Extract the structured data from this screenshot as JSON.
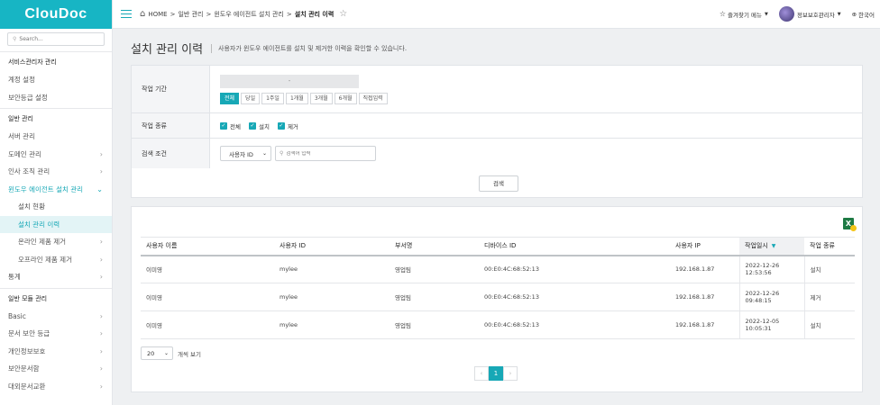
{
  "app": {
    "logo": "ClouDoc"
  },
  "sidebar": {
    "search_placeholder": "Search...",
    "sections": [
      {
        "title": "서비스관리자 관리",
        "items": [
          {
            "label": "계정 설정",
            "chevron": ""
          },
          {
            "label": "보안등급 설정",
            "chevron": ""
          }
        ]
      },
      {
        "title": "일반 관리",
        "items": [
          {
            "label": "서버 관리",
            "chevron": ""
          },
          {
            "label": "도메인 관리",
            "chevron": "›"
          },
          {
            "label": "인사 조직 관리",
            "chevron": "›"
          },
          {
            "label": "윈도우 에이전트 설치 관리",
            "chevron": "⌄"
          },
          {
            "label": "설치 현황",
            "chevron": ""
          },
          {
            "label": "설치 관리 이력",
            "chevron": ""
          },
          {
            "label": "온라인 제품 제거",
            "chevron": "›"
          },
          {
            "label": "오프라인 제품 제거",
            "chevron": "›"
          },
          {
            "label": "통계",
            "chevron": "›"
          }
        ]
      },
      {
        "title": "일반 모듈 관리",
        "items": [
          {
            "label": "Basic",
            "chevron": "›"
          },
          {
            "label": "문서 보안 등급",
            "chevron": "›"
          },
          {
            "label": "개인정보보호",
            "chevron": "›"
          },
          {
            "label": "보안문서함",
            "chevron": "›"
          },
          {
            "label": "대외문서교환",
            "chevron": "›"
          }
        ]
      }
    ]
  },
  "topbar": {
    "breadcrumb": [
      "HOME",
      "일반 관리",
      "윈도우 에이전트 설치 관리",
      "설치 관리 이력"
    ],
    "favorites": "즐겨찾기 메뉴",
    "user": "정보보호관리자",
    "language": "한국어"
  },
  "page": {
    "title": "설치 관리 이력",
    "description": "사용자가 윈도우 에이전트를 설치 및 제거한 이력을 확인할 수 있습니다."
  },
  "filter": {
    "period_label": "작업 기간",
    "date_value": "-",
    "period_buttons": [
      "전체",
      "당일",
      "1주일",
      "1개월",
      "3개월",
      "6개월",
      "직접입력"
    ],
    "type_label": "작업 종류",
    "types": [
      "전체",
      "설치",
      "제거"
    ],
    "condition_label": "검색 조건",
    "condition_select": "사용자 ID",
    "keyword_placeholder": "검색어 입력",
    "search_button": "검색"
  },
  "table": {
    "headers": [
      "사용자 이름",
      "사용자 ID",
      "부서명",
      "디바이스 ID",
      "사용자 IP",
      "작업일시",
      "작업 종류"
    ],
    "rows": [
      [
        "이미영",
        "mylee",
        "영업팀",
        "00:E0:4C:68:52:13",
        "192.168.1.87",
        "2022-12-26",
        "12:53:56",
        "설치"
      ],
      [
        "이미영",
        "mylee",
        "영업팀",
        "00:E0:4C:68:52:13",
        "192.168.1.87",
        "2022-12-26",
        "09:48:15",
        "제거"
      ],
      [
        "이미영",
        "mylee",
        "영업팀",
        "00:E0:4C:68:52:13",
        "192.168.1.87",
        "2022-12-05",
        "10:05:31",
        "설치"
      ]
    ]
  },
  "pager": {
    "page_size": "20",
    "page_size_label": "개씩 보기",
    "prev": "‹",
    "current": "1",
    "next": "›"
  },
  "colors": {
    "accent": "#17a8b6",
    "logo_bg": "#17b5c4"
  }
}
